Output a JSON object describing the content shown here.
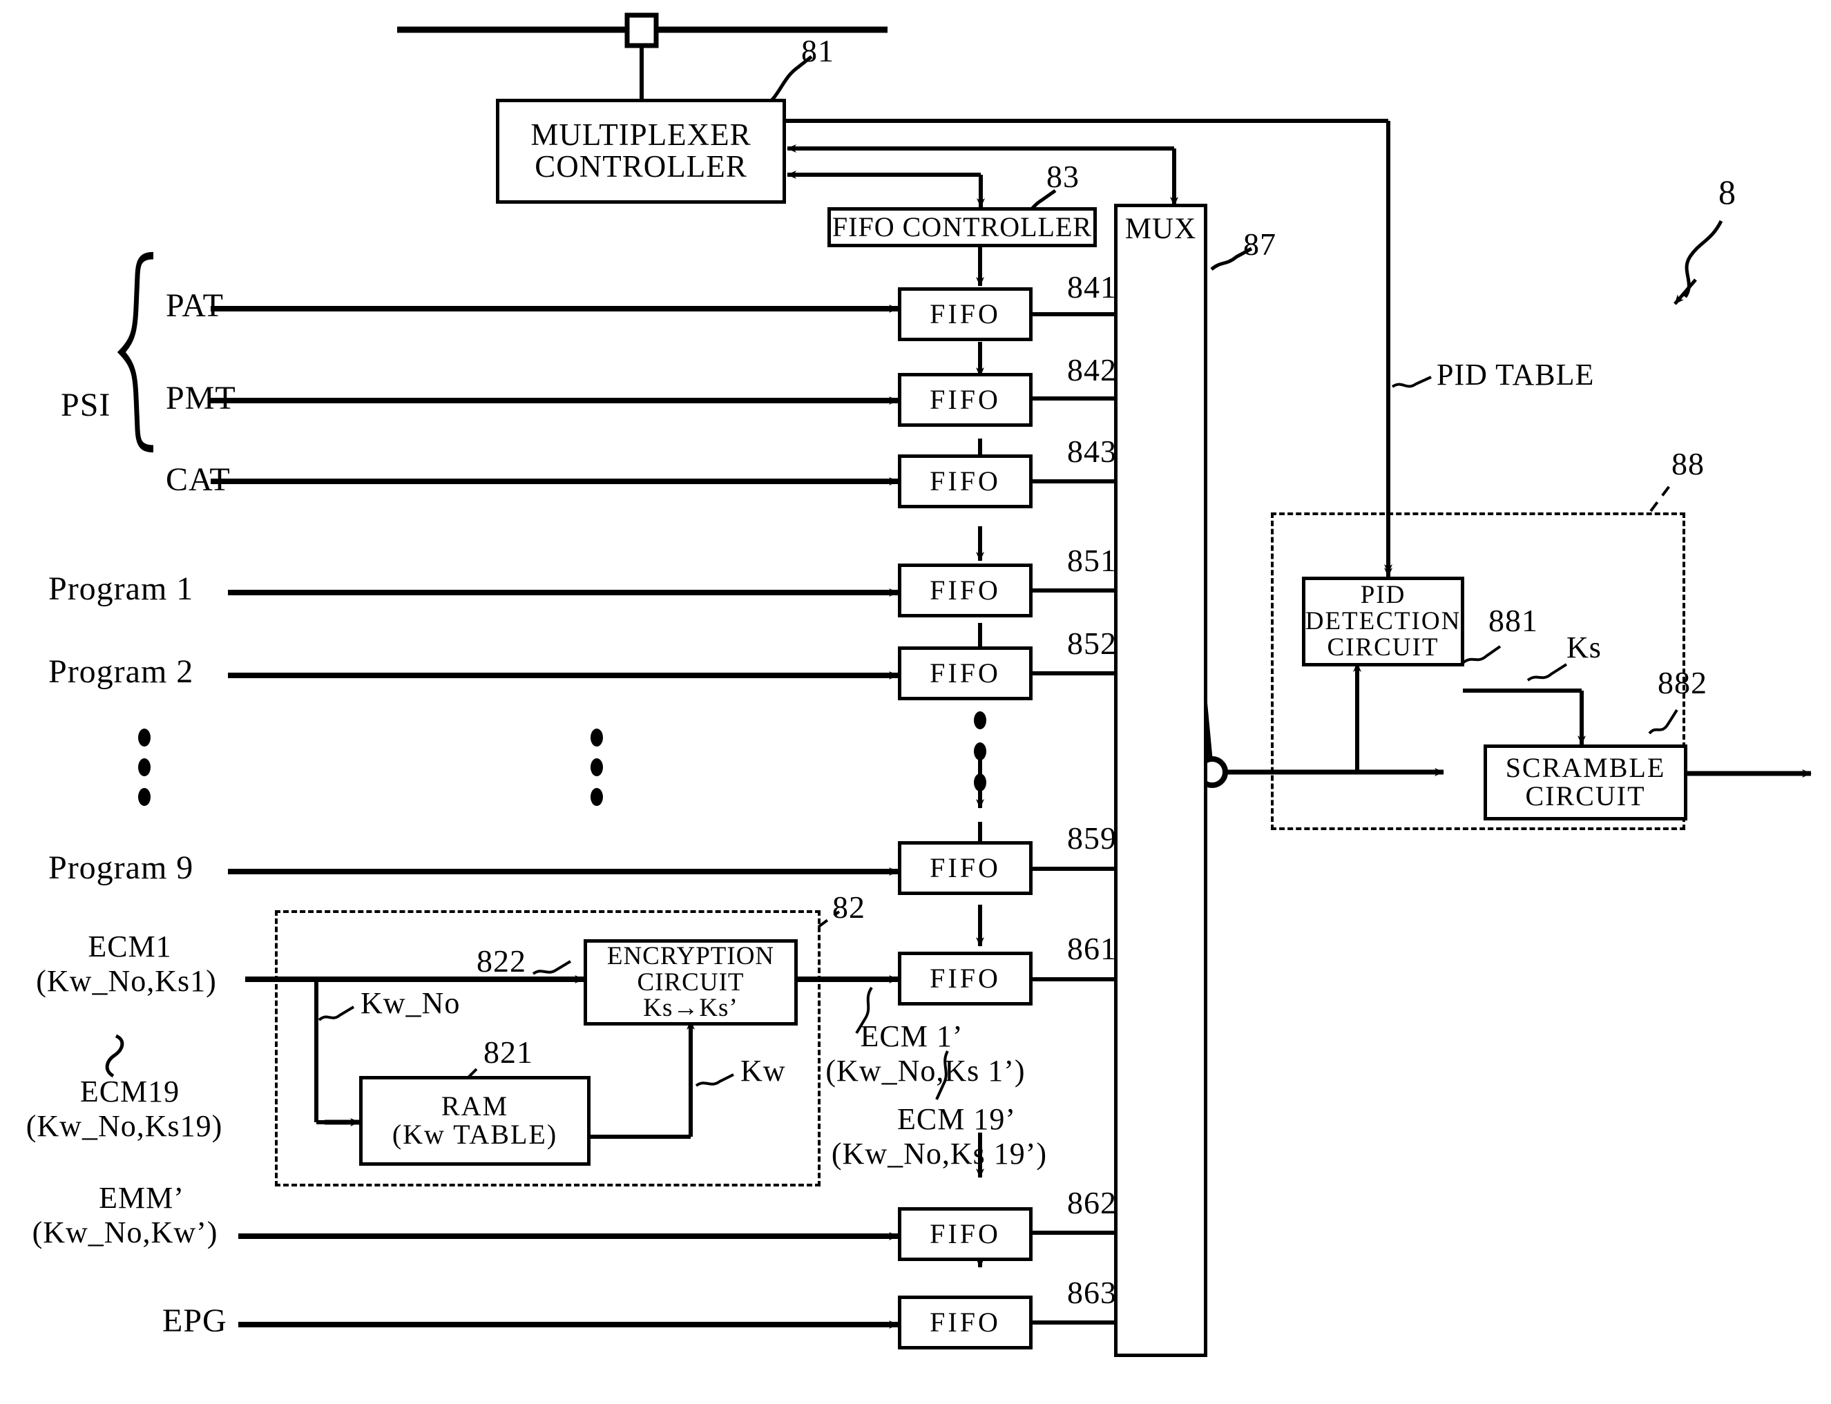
{
  "figure": {
    "system_ref": "8",
    "pid_table_label": "PID TABLE"
  },
  "blocks": {
    "multiplexer_controller": {
      "line1": "MULTIPLEXER",
      "line2": "CONTROLLER",
      "ref": "81"
    },
    "fifo_controller": {
      "label": "FIFO CONTROLLER",
      "ref": "83"
    },
    "mux": {
      "label": "MUX",
      "ref": "87"
    },
    "pid_detection": {
      "line1": "PID",
      "line2": "DETECTION",
      "line3": "CIRCUIT",
      "ref": "881"
    },
    "scramble": {
      "line1": "SCRAMBLE",
      "line2": "CIRCUIT",
      "ref": "882"
    },
    "scramble_group_ref": "88",
    "encryption": {
      "line1": "ENCRYPTION",
      "line2": "CIRCUIT",
      "line3": "Ks→Ks’",
      "ref": "822"
    },
    "ram": {
      "line1": "RAM",
      "line2": "(Kw TABLE)",
      "ref": "821"
    },
    "encryption_group_ref": "82"
  },
  "signals": {
    "ks": "Ks",
    "kw": "Kw",
    "kw_no": "Kw_No"
  },
  "psi": {
    "group_label": "PSI",
    "items": [
      "PAT",
      "PMT",
      "CAT"
    ]
  },
  "programs": [
    {
      "label": "Program 1"
    },
    {
      "label": "Program 2"
    },
    {
      "label": "Program 9"
    }
  ],
  "ecm_in": {
    "line1": "ECM1",
    "line2": "(Kw_No,Ks1)",
    "line3": "ECM19",
    "line4": "(Kw_No,Ks19)"
  },
  "ecm_out": {
    "line1": "ECM 1’",
    "line2": "(Kw_No,Ks 1’)",
    "line3": "ECM 19’",
    "line4": "(Kw_No,Ks 19’)"
  },
  "emm": {
    "line1": "EMM’",
    "line2": "(Kw_No,Kw’)"
  },
  "epg": {
    "label": "EPG"
  },
  "fifos": [
    {
      "name": "FIFO",
      "ref": "841"
    },
    {
      "name": "FIFO",
      "ref": "842"
    },
    {
      "name": "FIFO",
      "ref": "843"
    },
    {
      "name": "FIFO",
      "ref": "851"
    },
    {
      "name": "FIFO",
      "ref": "852"
    },
    {
      "name": "FIFO",
      "ref": "859"
    },
    {
      "name": "FIFO",
      "ref": "861"
    },
    {
      "name": "FIFO",
      "ref": "862"
    },
    {
      "name": "FIFO",
      "ref": "863"
    }
  ],
  "colors": {
    "line": "#000000",
    "background": "#ffffff"
  }
}
